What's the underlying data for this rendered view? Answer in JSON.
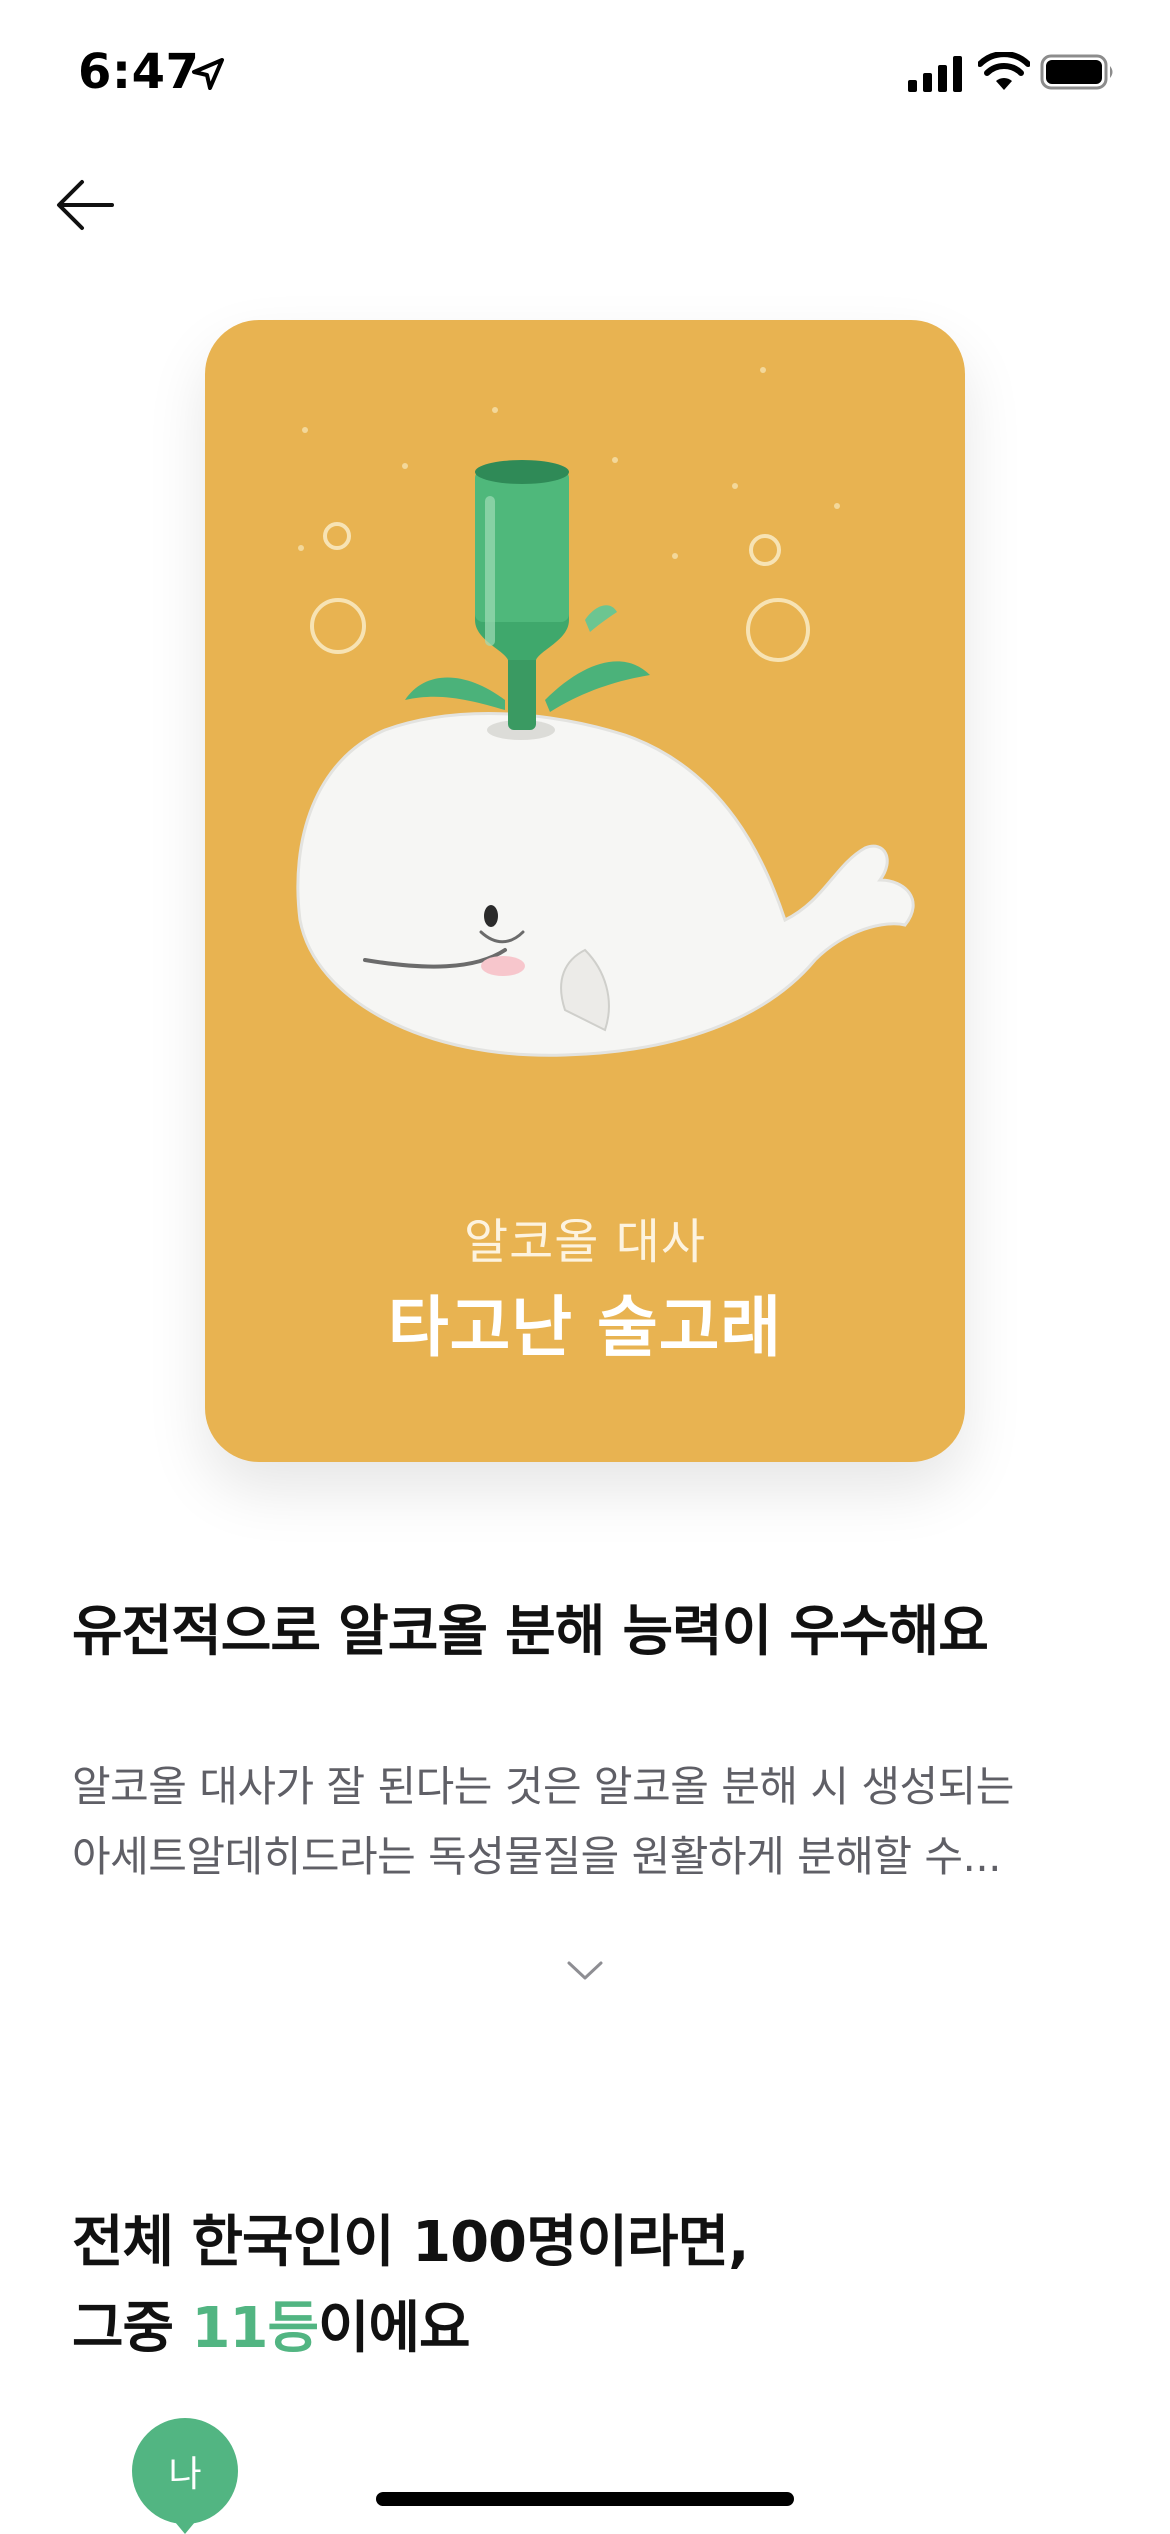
{
  "status_bar": {
    "time": "6:47",
    "icons": [
      "location-arrow-icon",
      "cellular-signal-icon",
      "wifi-icon",
      "battery-icon"
    ]
  },
  "nav": {
    "back_icon": "arrow-left-icon"
  },
  "card": {
    "background_color": "#e8b351",
    "subtitle": "알코올 대사",
    "title": "타고난 술고래",
    "illustration": "whale-with-soju-bottle"
  },
  "section": {
    "heading": "유전적으로 알코올 분해 능력이 우수해요",
    "description_lines": [
      "알코올 대사가 잘 된다는 것은 알코올 분해 시 생성되는",
      "아세트알데히드라는 독성물질을 원활하게 분해할 수..."
    ],
    "expand_icon": "chevron-down-icon"
  },
  "ranking": {
    "line1": "전체 한국인이 100명이라면,",
    "line2_prefix": "그중 ",
    "rank": "11등",
    "line2_suffix": "이에요",
    "accent_color": "#52b582",
    "me_label": "나"
  }
}
